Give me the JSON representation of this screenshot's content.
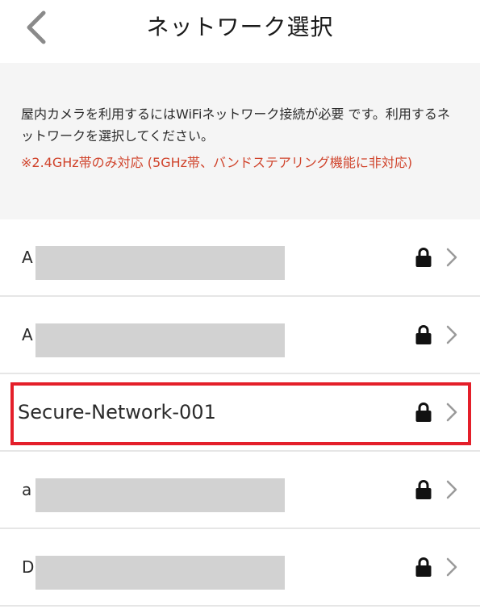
{
  "header": {
    "title": "ネットワーク選択",
    "back_icon": "chevron-left-icon"
  },
  "info": {
    "description": "屋内カメラを利用するにはWiFiネットワーク接続が必要 です。利用するネットワークを選択してください。",
    "note": "※2.4GHz帯のみ対応 (5GHz帯、バンドステアリング機能に非対応)",
    "note_color": "#d0432b"
  },
  "networks": [
    {
      "initial": "A",
      "masked": true,
      "secured": true
    },
    {
      "initial": "A",
      "masked": true,
      "secured": true
    },
    {
      "name": "Secure-Network-001",
      "masked": false,
      "secured": true,
      "highlighted": true
    },
    {
      "initial": "a",
      "masked": true,
      "secured": true
    },
    {
      "initial": "D",
      "masked": true,
      "secured": true
    }
  ],
  "icons": {
    "lock": "lock-icon",
    "chevron": "chevron-right-icon"
  },
  "colors": {
    "highlight_border": "#e41f2a",
    "panel_background": "#f5f5f5",
    "mask": "#d2d2d2"
  }
}
